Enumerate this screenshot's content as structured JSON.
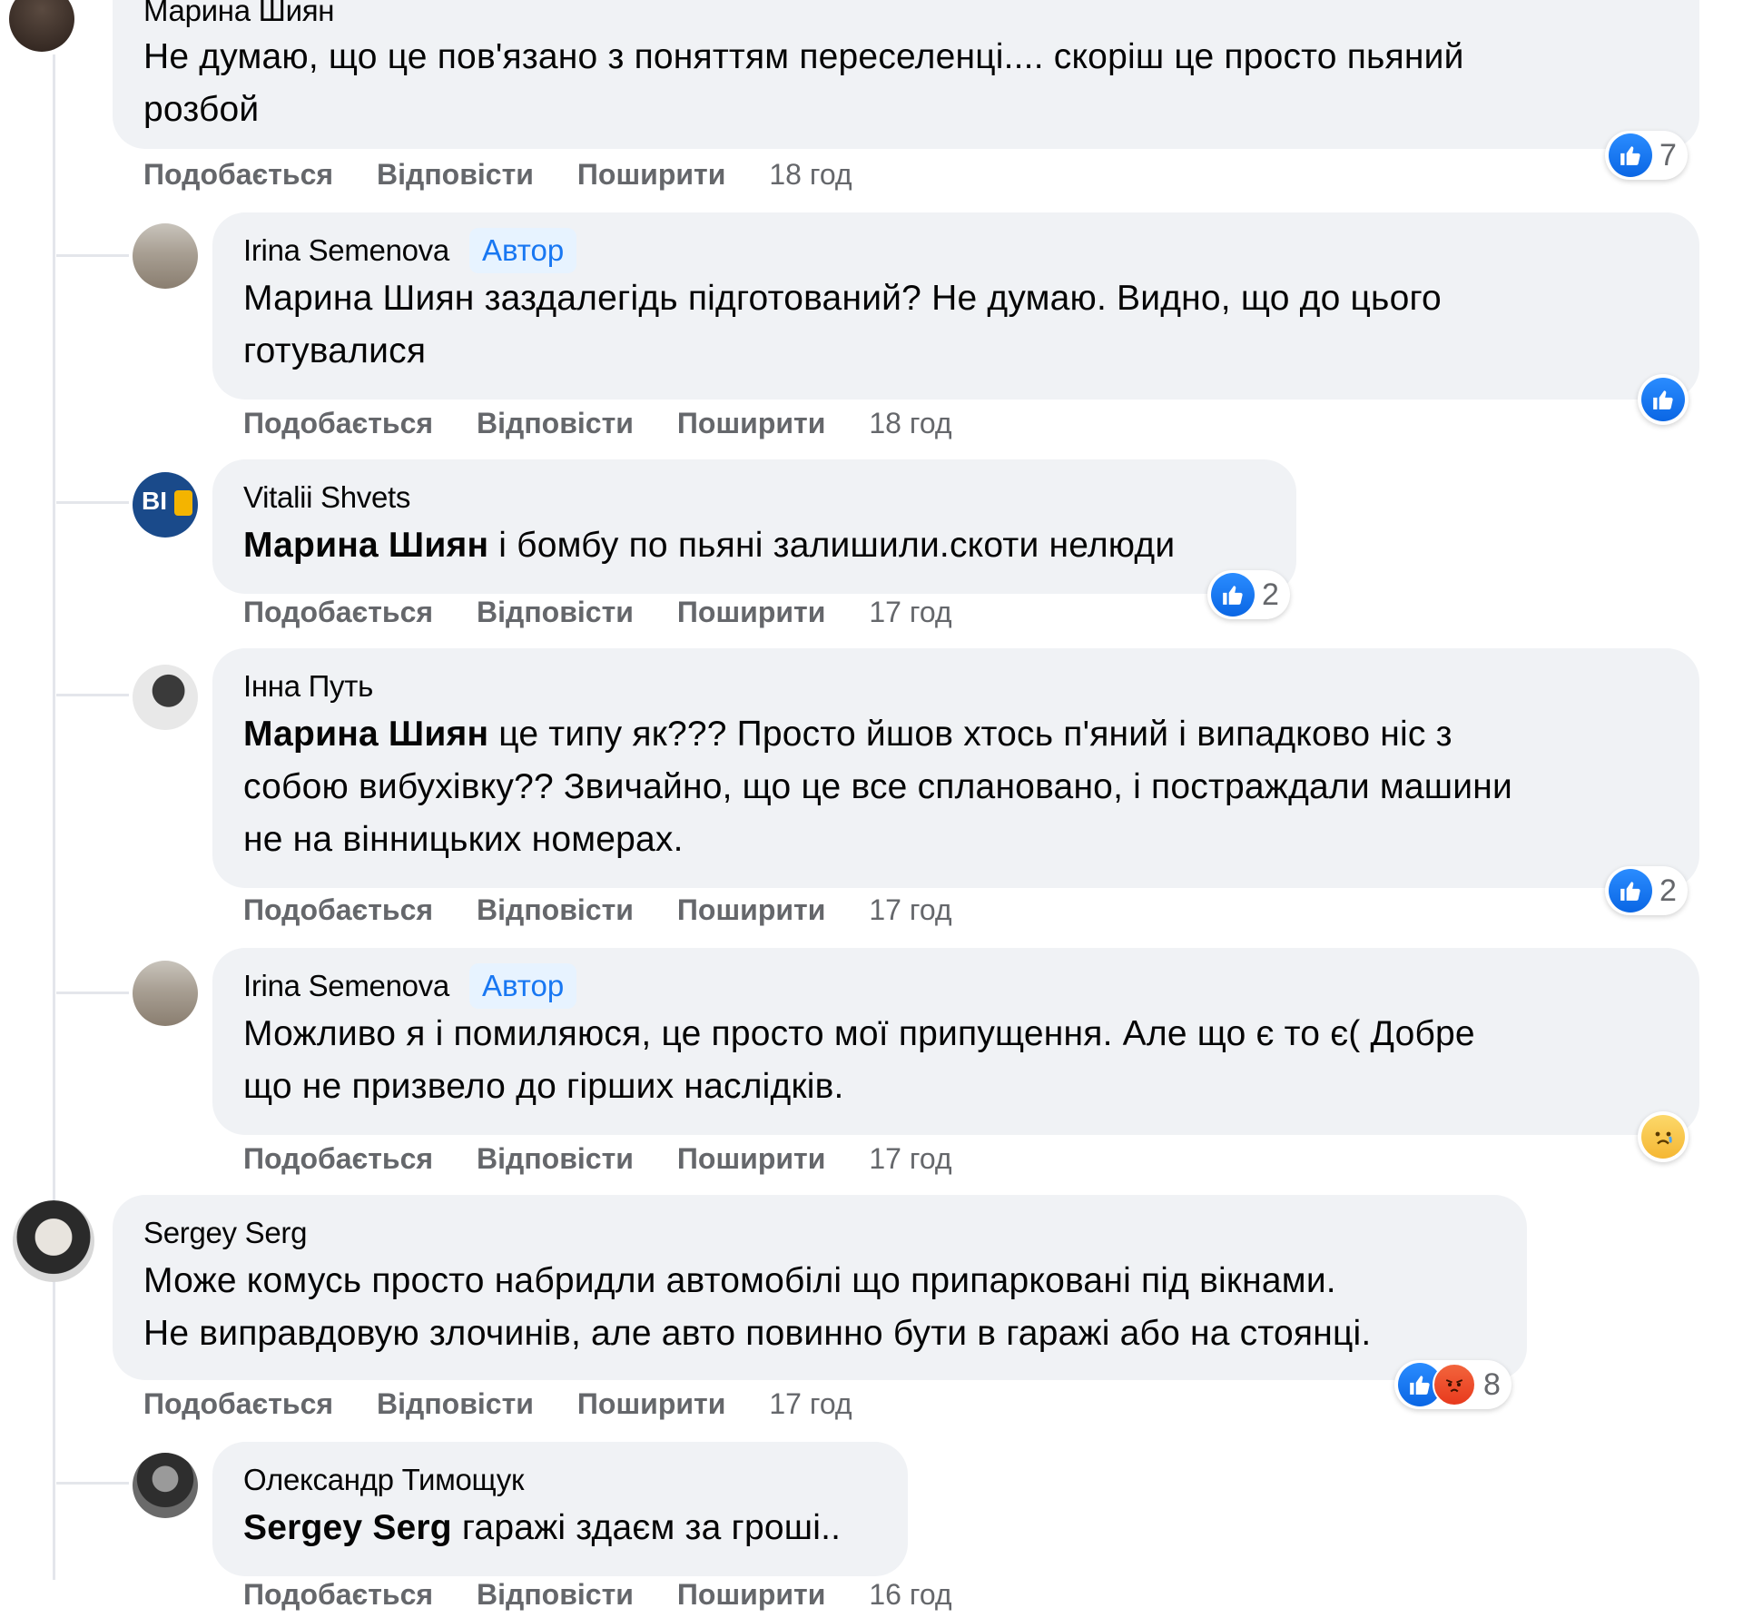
{
  "comments": [
    {
      "author": "Марина Шиян",
      "text_lines": [
        "Не думаю, що це пов'язано з поняттям переселенці.... скоріш це просто пьяний",
        "розбой"
      ],
      "like": "Подобається",
      "reply": "Відповісти",
      "share": "Поширити",
      "time": "18 год",
      "reaction_count": "7"
    },
    {
      "author": "Irina Semenova",
      "badge": "Автор",
      "text_lines": [
        "Марина Шиян заздалегідь підготований? Не думаю. Видно, що до цього",
        "готувалися"
      ],
      "like": "Подобається",
      "reply": "Відповісти",
      "share": "Поширити",
      "time": "18 год"
    },
    {
      "author": "Vitalii Shvets",
      "mention": "Марина Шиян",
      "text_lines": [
        " і бомбу по пьяні залишили.скоти нелюди"
      ],
      "like": "Подобається",
      "reply": "Відповісти",
      "share": "Поширити",
      "time": "17 год",
      "reaction_count": "2"
    },
    {
      "author": "Інна Путь",
      "mention": "Марина Шиян",
      "text_lines": [
        " це типу як??? Просто йшов хтось п'яний і випадково ніс з",
        "собою вибухівку?? Звичайно, що це все сплановано, і постраждали машини",
        "не на вінницьких номерах."
      ],
      "like": "Подобається",
      "reply": "Відповісти",
      "share": "Поширити",
      "time": "17 год",
      "reaction_count": "2"
    },
    {
      "author": "Irina Semenova",
      "badge": "Автор",
      "text_lines": [
        "Можливо я і помиляюся, це просто мої припущення. Але що є то є( Добре",
        "що не призвело до гірших наслідків."
      ],
      "like": "Подобається",
      "reply": "Відповісти",
      "share": "Поширити",
      "time": "17 год"
    },
    {
      "author": "Sergey Serg",
      "text_lines": [
        "Може комусь просто набридли автомобілі що припарковані під вікнами.",
        "Не виправдовую злочинів, але авто повинно бути в гаражі або на стоянці."
      ],
      "like": "Подобається",
      "reply": "Відповісти",
      "share": "Поширити",
      "time": "17 год",
      "reaction_count": "8"
    },
    {
      "author": "Олександр Тимощук",
      "mention": "Sergey Serg",
      "text_lines": [
        " гаражі здаєм за гроші.."
      ],
      "like": "Подобається",
      "reply": "Відповісти",
      "share": "Поширити",
      "time": "16 год"
    }
  ],
  "colors": {
    "bubble": "#f0f2f5",
    "meta": "#65676b",
    "like_blue": "#1877f2",
    "badge_bg": "#e7f3ff"
  }
}
